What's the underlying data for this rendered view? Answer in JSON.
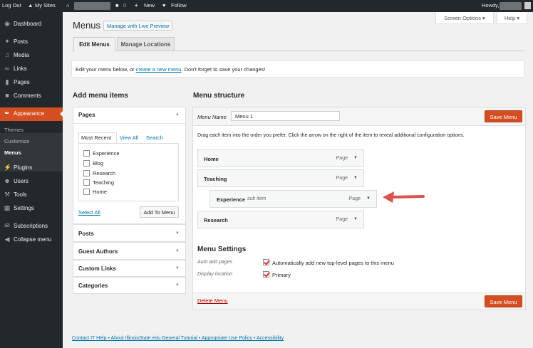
{
  "adminbar": {
    "logout": "Log Out",
    "my_sites": "My Sites",
    "comments_count": "0",
    "new": "New",
    "follow": "Follow",
    "howdy": "Howdy,"
  },
  "sidebar": {
    "dashboard": "Dashboard",
    "posts": "Posts",
    "media": "Media",
    "links": "Links",
    "pages": "Pages",
    "comments": "Comments",
    "appearance": "Appearance",
    "sub": {
      "themes": "Themes",
      "customize": "Customize",
      "menus": "Menus"
    },
    "plugins": "Plugins",
    "users": "Users",
    "tools": "Tools",
    "settings": "Settings",
    "subscriptions": "Subscriptions",
    "collapse": "Collapse menu"
  },
  "screen_options": "Screen Options",
  "help": "Help",
  "header": {
    "title": "Menus",
    "live_preview": "Manage with Live Preview"
  },
  "tabs": {
    "edit": "Edit Menus",
    "locations": "Manage Locations"
  },
  "notice": {
    "before": "Edit your menu below, or ",
    "link": "create a new menu",
    "after": ". Don't forget to save your changes!"
  },
  "add_items": {
    "heading": "Add menu items",
    "pages": {
      "title": "Pages",
      "tabs": {
        "recent": "Most Recent",
        "all": "View All",
        "search": "Search"
      },
      "items": [
        "Experience",
        "Blog",
        "Research",
        "Teaching",
        "Home"
      ],
      "select_all": "Select All",
      "add_button": "Add To Menu"
    },
    "posts": "Posts",
    "guest_authors": "Guest Authors",
    "custom_links": "Custom Links",
    "categories": "Categories"
  },
  "structure": {
    "heading": "Menu structure",
    "menu_name_label": "Menu Name",
    "menu_name_value": "Menu 1",
    "save": "Save Menu",
    "instructions": "Drag each item into the order you prefer. Click the arrow on the right of the item to reveal additional configuration options.",
    "items": [
      {
        "title": "Home",
        "sub": "",
        "type": "Page"
      },
      {
        "title": "Teaching",
        "sub": "",
        "type": "Page"
      },
      {
        "title": "Experience",
        "sub": "sub item",
        "type": "Page"
      },
      {
        "title": "Research",
        "sub": "",
        "type": "Page"
      }
    ],
    "settings_heading": "Menu Settings",
    "auto_add_label": "Auto add pages",
    "auto_add_text": "Automatically add new top-level pages to this menu",
    "display_label": "Display location",
    "display_text": "Primary",
    "delete": "Delete Menu"
  },
  "footer": "Contact IT Help • About IllinoisState.edu General Tutorial • Appropriate Use Policy • Accessibility",
  "colors": {
    "accent": "#d54e21",
    "link": "#0073aa",
    "adminbar": "#23282d",
    "annotation_arrow": "#d9534f"
  }
}
